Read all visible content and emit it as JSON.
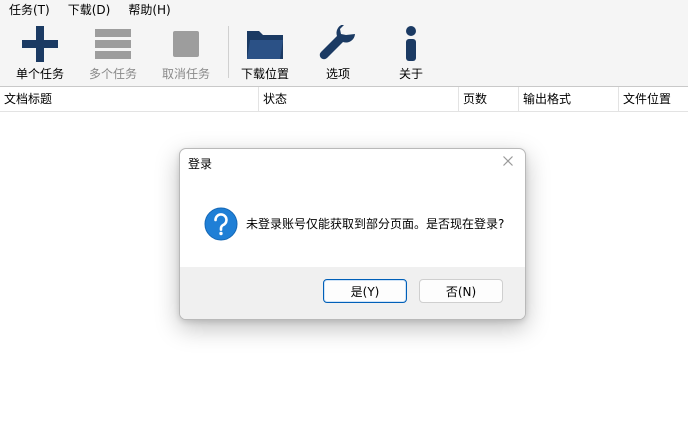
{
  "menubar": {
    "items": [
      {
        "label": "任务(T)"
      },
      {
        "label": "下载(D)"
      },
      {
        "label": "帮助(H)"
      }
    ]
  },
  "toolbar": {
    "buttons": [
      {
        "label": "单个任务",
        "icon": "plus-icon",
        "enabled": true
      },
      {
        "label": "多个任务",
        "icon": "list-icon",
        "enabled": false
      },
      {
        "label": "取消任务",
        "icon": "stop-icon",
        "enabled": false
      },
      {
        "label": "下载位置",
        "icon": "folder-icon",
        "enabled": true
      },
      {
        "label": "选项",
        "icon": "wrench-icon",
        "enabled": true
      },
      {
        "label": "关于",
        "icon": "info-icon",
        "enabled": true
      }
    ]
  },
  "table": {
    "columns": [
      "文档标题",
      "状态",
      "页数",
      "输出格式",
      "文件位置"
    ],
    "rows": []
  },
  "dialog": {
    "title": "登录",
    "icon": "question-icon",
    "message": "未登录账号仅能获取到部分页面。是否现在登录?",
    "yes_label": "是(Y)",
    "no_label": "否(N)"
  },
  "colors": {
    "icon_blue": "#1b3a63",
    "disabled_gray": "#9d9d9d",
    "accent": "#005fb8",
    "question_blue": "#1f7fd6"
  }
}
